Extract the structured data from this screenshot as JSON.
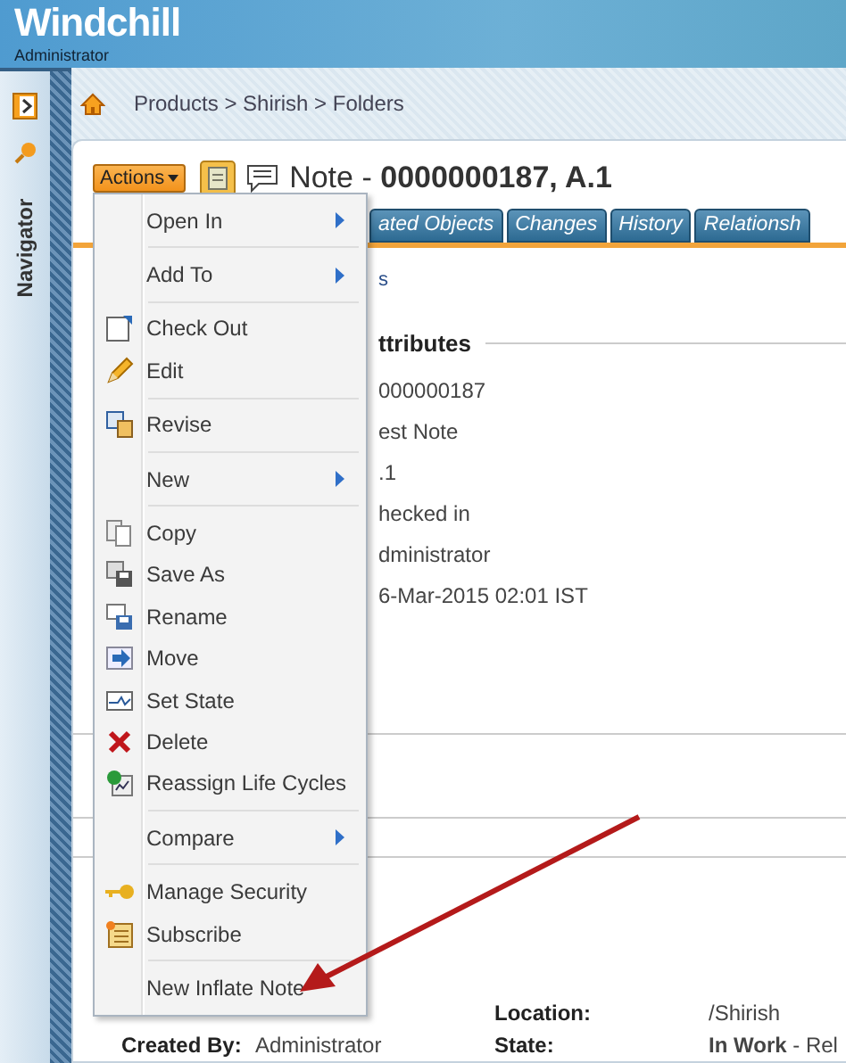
{
  "app": {
    "title": "Windchill",
    "user": "Administrator"
  },
  "navigator": {
    "label": "Navigator"
  },
  "breadcrumb": "Products > Shirish > Folders",
  "object": {
    "actions_label": "Actions",
    "title": "Note - **0000000187, A.1**"
  },
  "tabs": [
    {
      "label": "ated Objects",
      "selected": false
    },
    {
      "label": "Changes",
      "selected": false
    },
    {
      "label": "History",
      "selected": false
    },
    {
      "label": "Relationsh",
      "selected": false
    }
  ],
  "content": {
    "link": "s",
    "section": "ttributes",
    "values": [
      "000000187",
      "est Note",
      ".1",
      "hecked in",
      "dministrator",
      "6-Mar-2015 02:01 IST"
    ]
  },
  "menu": [
    [
      {
        "label": "Open In",
        "submenu": true
      }
    ],
    [
      {
        "label": "Add To",
        "submenu": true
      }
    ],
    [
      {
        "label": "Check Out",
        "submenu": false
      },
      {
        "label": "Edit",
        "submenu": false
      }
    ],
    [
      {
        "label": "Revise",
        "submenu": false
      }
    ],
    [
      {
        "label": "New",
        "submenu": true
      }
    ],
    [
      {
        "label": "Copy",
        "submenu": false
      },
      {
        "label": "Save As",
        "submenu": false
      },
      {
        "label": "Rename",
        "submenu": false
      },
      {
        "label": "Move",
        "submenu": false
      },
      {
        "label": "Set State",
        "submenu": false
      },
      {
        "label": "Delete",
        "submenu": false
      },
      {
        "label": "Reassign Life Cycles",
        "submenu": false
      }
    ],
    [
      {
        "label": "Compare",
        "submenu": true
      }
    ],
    [
      {
        "label": "Manage Security",
        "submenu": false
      },
      {
        "label": "Subscribe",
        "submenu": false
      }
    ],
    [
      {
        "label": "New Inflate Note",
        "submenu": false
      }
    ]
  ],
  "details": [
    [
      {
        "label": "Location:",
        "value": "/Shirish"
      }
    ],
    [
      {
        "label": "Created By:",
        "value": "Administrator"
      },
      {
        "label": "State:",
        "value": "**In Work** - Rel"
      }
    ]
  ]
}
